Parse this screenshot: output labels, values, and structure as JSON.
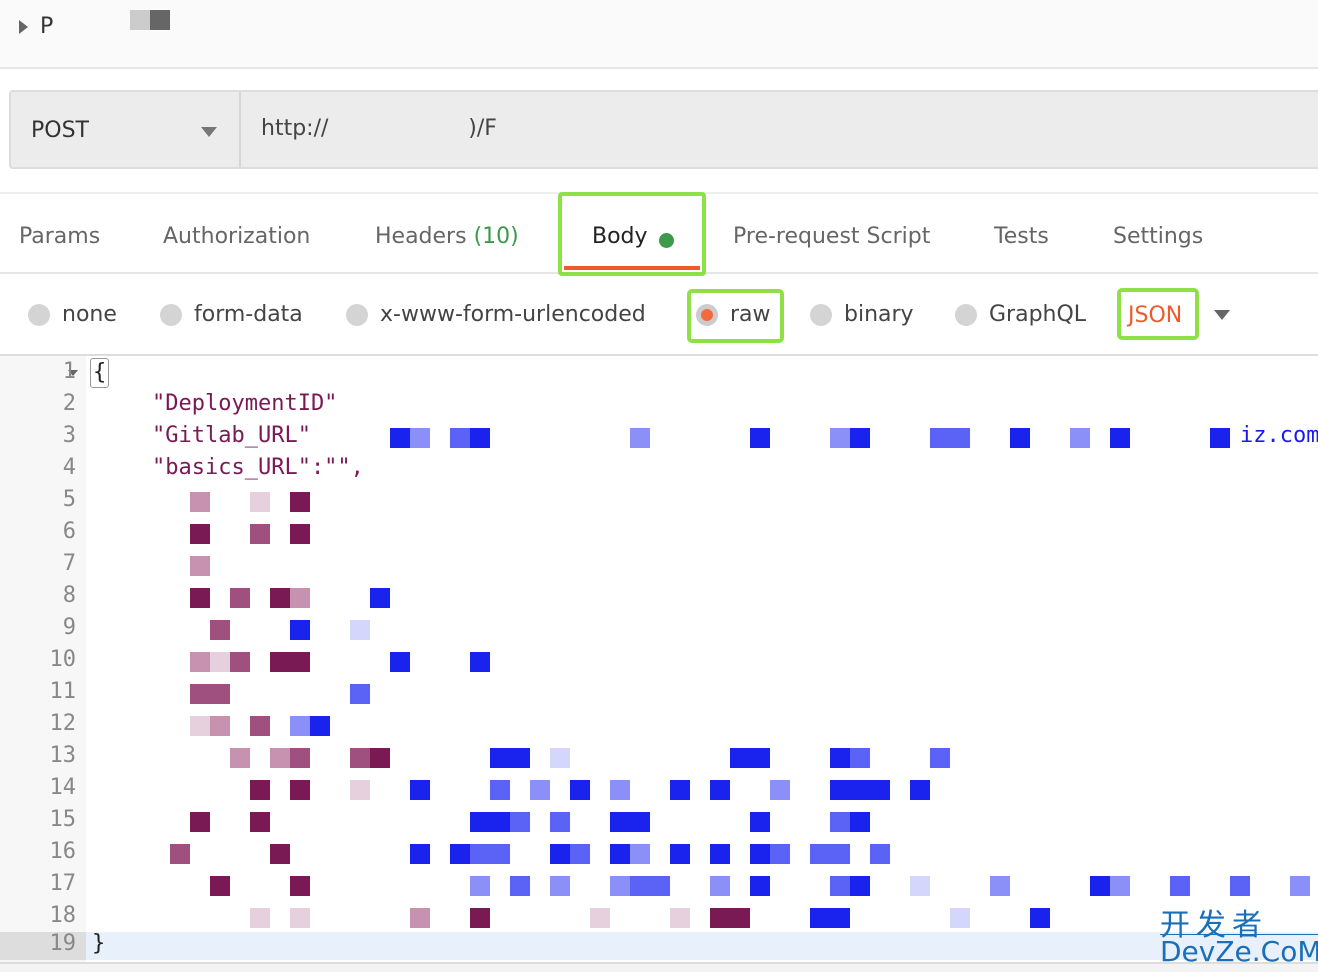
{
  "header": {
    "title": "P"
  },
  "request": {
    "method": "POST",
    "url": "http://                    )/F"
  },
  "tabs": [
    {
      "label": "Params"
    },
    {
      "label": "Authorization"
    },
    {
      "label": "Headers",
      "count": "(10)"
    },
    {
      "label": "Body",
      "active": true
    },
    {
      "label": "Pre-request Script"
    },
    {
      "label": "Tests"
    },
    {
      "label": "Settings"
    }
  ],
  "body_types": [
    {
      "label": "none"
    },
    {
      "label": "form-data"
    },
    {
      "label": "x-www-form-urlencoded"
    },
    {
      "label": "raw",
      "selected": true
    },
    {
      "label": "binary"
    },
    {
      "label": "GraphQL"
    }
  ],
  "format": "JSON",
  "editor": {
    "line_numbers": [
      "1",
      "2",
      "3",
      "4",
      "5",
      "6",
      "7",
      "8",
      "9",
      "10",
      "11",
      "12",
      "13",
      "14",
      "15",
      "16",
      "17",
      "18",
      "19"
    ],
    "open_brace": "{",
    "close_brace": "}",
    "lines": {
      "l2": "\"DeploymentID\"",
      "l3": "\"Gitlab_URL\"",
      "l3_tail": "iz.com",
      "l4": "\"basics_URL\":\"\","
    }
  },
  "watermark": {
    "line1": "开发者",
    "line2": "DevZe.CoM"
  },
  "colors": {
    "highlight": "#8fe046",
    "accent": "#f05a2a",
    "key": "#7a1a55",
    "string": "#1a1aee"
  }
}
